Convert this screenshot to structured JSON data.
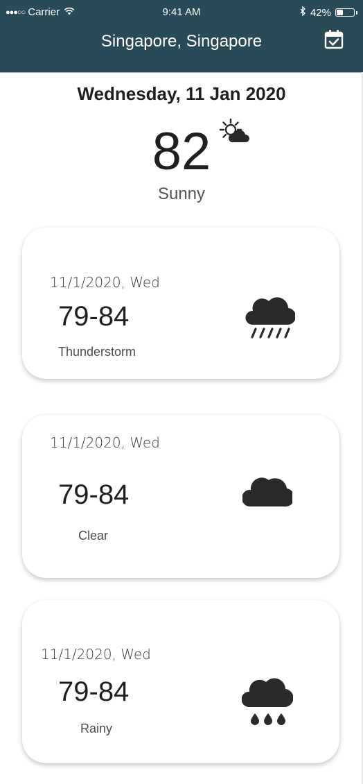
{
  "status_bar": {
    "carrier": "Carrier",
    "time": "9:41 AM",
    "battery_percent": "42%",
    "battery_level": 0.42
  },
  "header": {
    "title": "Singapore, Singapore",
    "calendar_icon": "calendar-check-icon"
  },
  "current": {
    "date": "Wednesday, 11 Jan 2020",
    "temperature": "82",
    "condition": "Sunny",
    "icon": "partly-sunny-icon"
  },
  "forecast": [
    {
      "date": "11/1/2020, Wed",
      "range": "79-84",
      "condition": "Thunderstorm",
      "icon": "cloud-rain-icon"
    },
    {
      "date": "11/1/2020, Wed",
      "range": "79-84",
      "condition": "Clear",
      "icon": "cloud-icon"
    },
    {
      "date": "11/1/2020, Wed",
      "range": "79-84",
      "condition": "Rainy",
      "icon": "cloud-drops-icon"
    }
  ],
  "colors": {
    "header_bg": "#2b4a58",
    "text": "#1f1f1f",
    "icon": "#2a2a2a"
  }
}
